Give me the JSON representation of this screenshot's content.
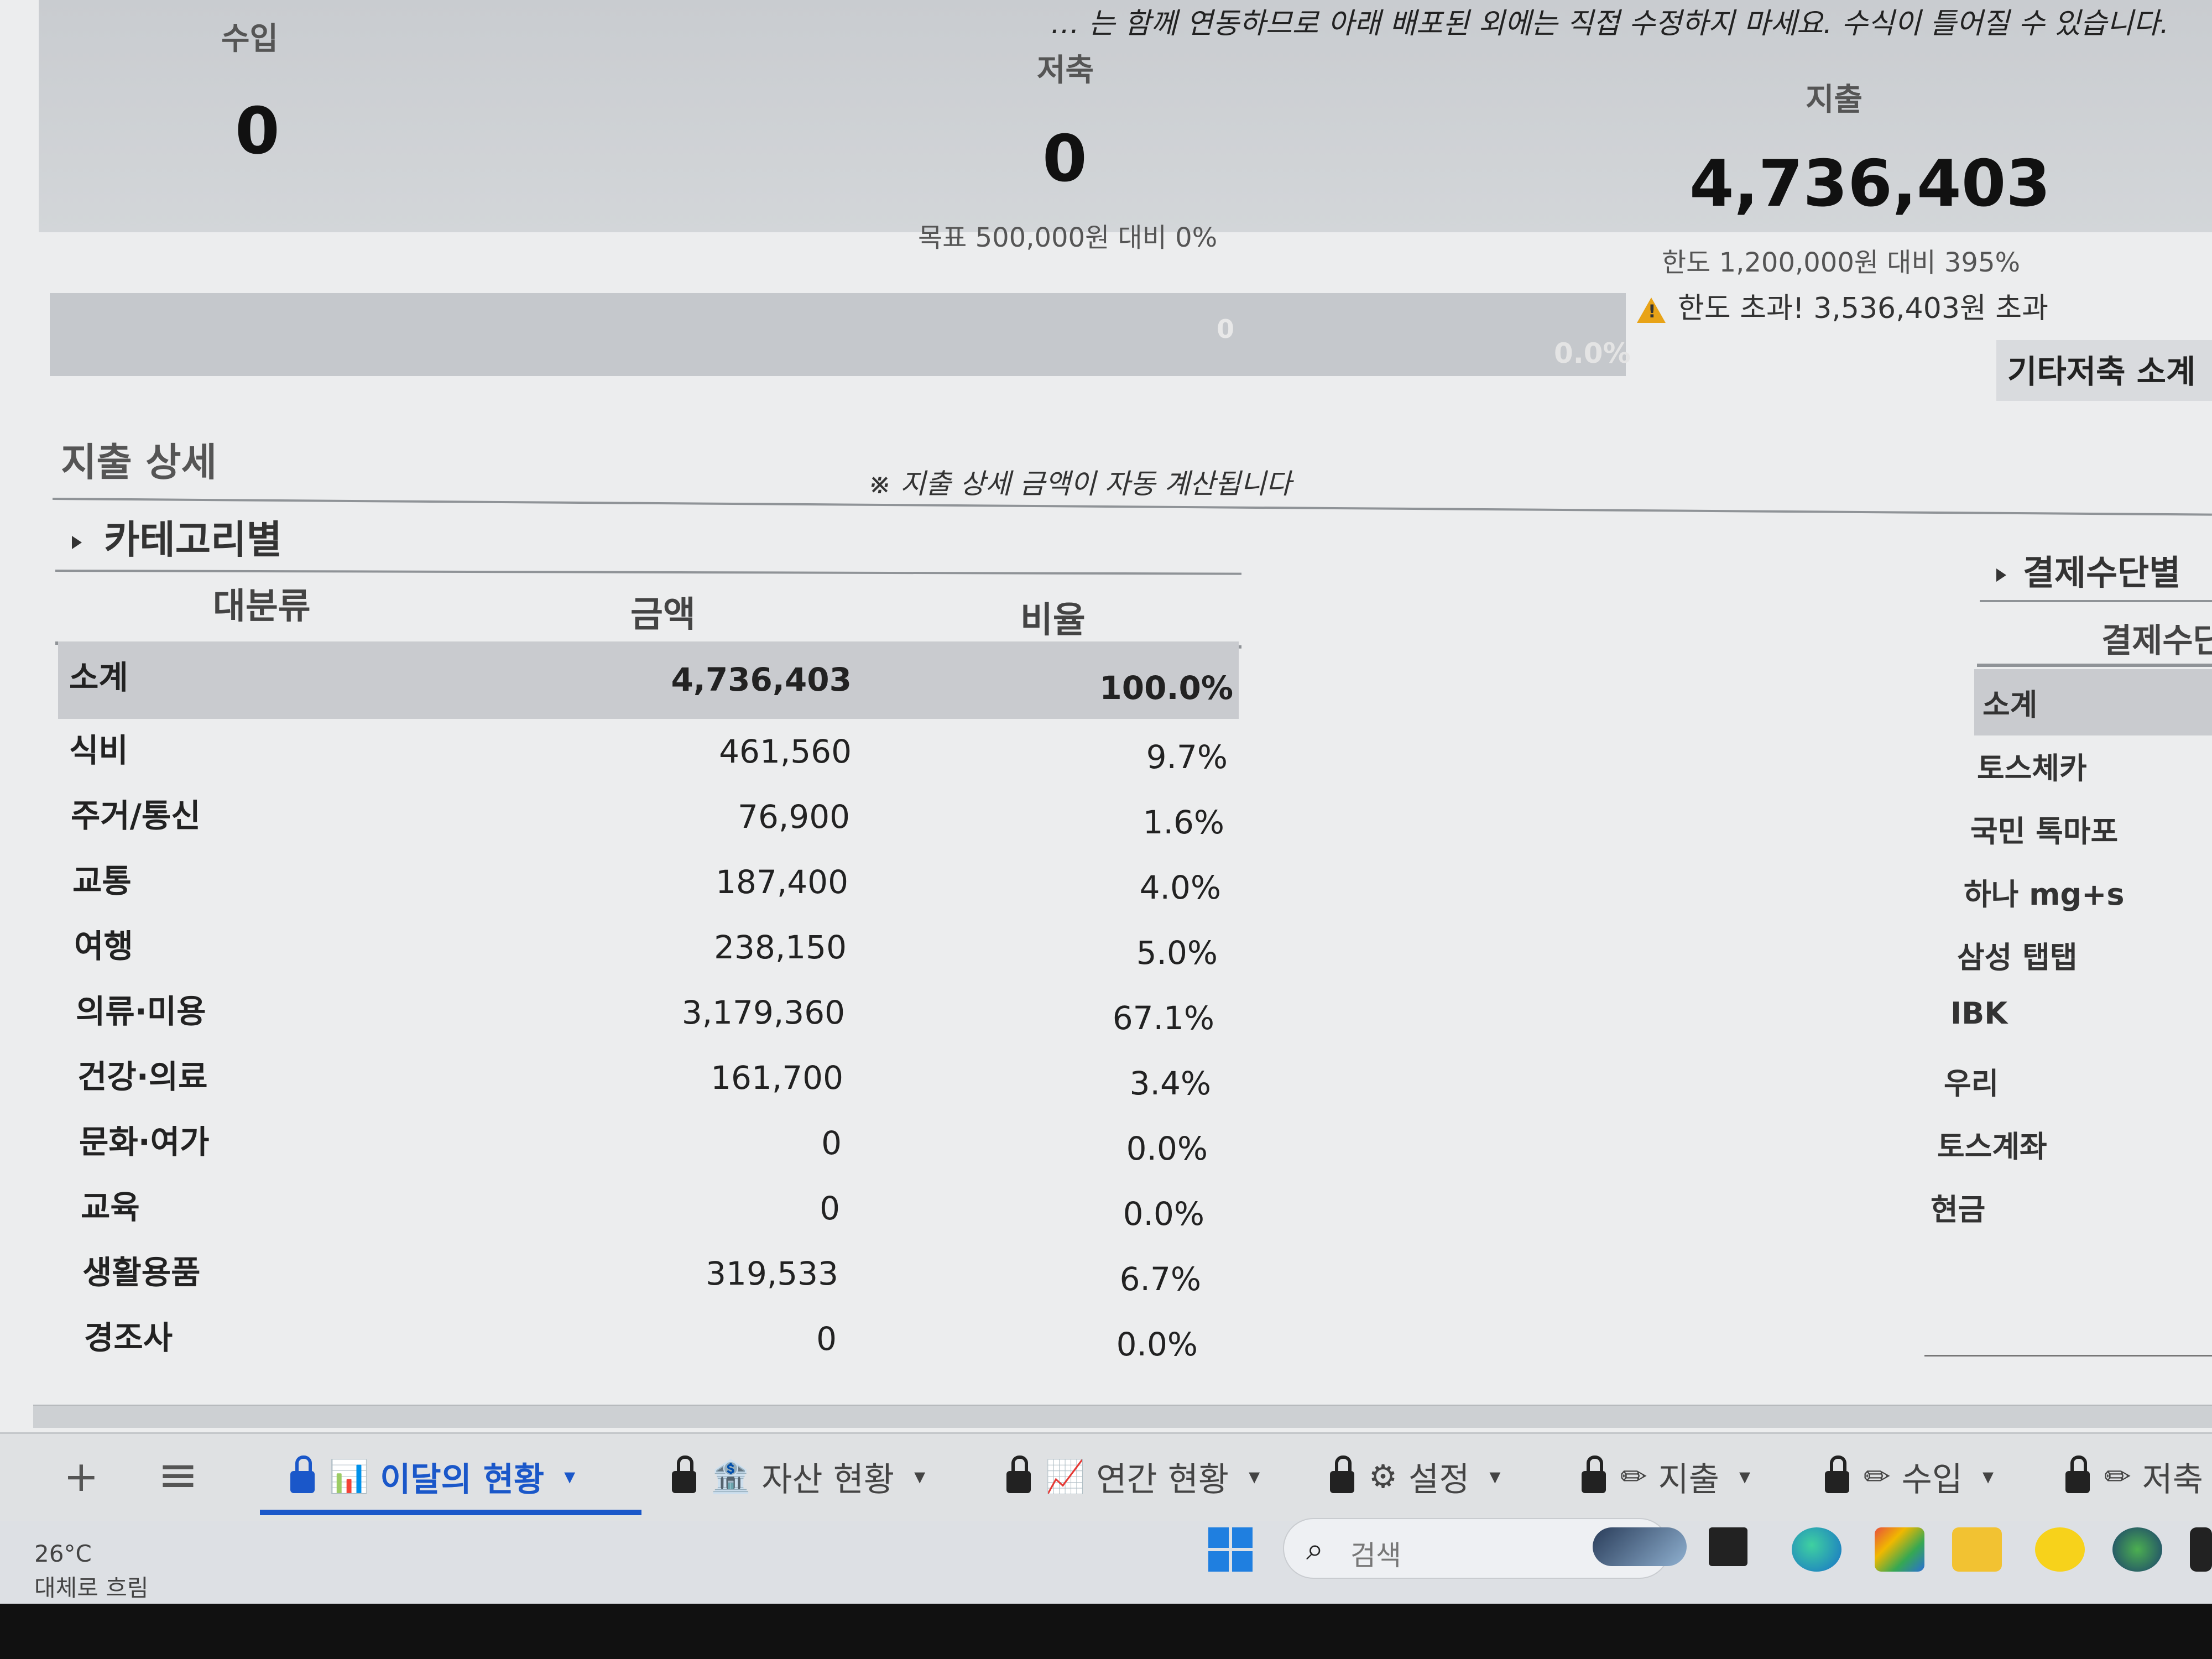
{
  "notice": "… 는 함께 연동하므로 아래 배포된 외에는 직접 수정하지 마세요. 수식이 틀어질 수 있습니다.",
  "summary": {
    "income": {
      "label": "수입",
      "value": "0"
    },
    "savings": {
      "label": "저축",
      "value": "0",
      "sub": "목표 500,000원 대비 0%"
    },
    "expense": {
      "label": "지출",
      "value": "4,736,403",
      "sub": "한도 1,200,000원 대비 395%",
      "warning": "한도 초과! 3,536,403원 초과"
    }
  },
  "savings_bar": {
    "amount": "0",
    "percent": "0.0%"
  },
  "other_savings_label": "기타저축 소계",
  "expense_detail": {
    "title": "지출 상세",
    "note": "※ 지출 상세 금액이 자동 계산됩니다",
    "by_category": {
      "title": "카테고리별",
      "headers": {
        "category": "대분류",
        "amount": "금액",
        "ratio": "비율"
      },
      "subtotal": {
        "category": "소계",
        "amount": "4,736,403",
        "ratio": "100.0%"
      },
      "rows": [
        {
          "category": "식비",
          "amount": "461,560",
          "ratio": "9.7%"
        },
        {
          "category": "주거/통신",
          "amount": "76,900",
          "ratio": "1.6%"
        },
        {
          "category": "교통",
          "amount": "187,400",
          "ratio": "4.0%"
        },
        {
          "category": "여행",
          "amount": "238,150",
          "ratio": "5.0%"
        },
        {
          "category": "의류·미용",
          "amount": "3,179,360",
          "ratio": "67.1%"
        },
        {
          "category": "건강·의료",
          "amount": "161,700",
          "ratio": "3.4%"
        },
        {
          "category": "문화·여가",
          "amount": "0",
          "ratio": "0.0%"
        },
        {
          "category": "교육",
          "amount": "0",
          "ratio": "0.0%"
        },
        {
          "category": "생활용품",
          "amount": "319,533",
          "ratio": "6.7%"
        },
        {
          "category": "경조사",
          "amount": "0",
          "ratio": "0.0%"
        }
      ]
    },
    "by_payment": {
      "title": "결제수단별",
      "header": "결제수단",
      "subtotal": "소계",
      "items": [
        "토스체카",
        "국민 톡마포",
        "하나 mg+s",
        "삼성 탭탭",
        "IBK",
        "우리",
        "토스계좌",
        "현금"
      ]
    }
  },
  "sheet_tabs": {
    "add_icon": "+",
    "menu_icon": "≡",
    "tabs": [
      {
        "label": "이달의 현황",
        "emoji": "📊",
        "active": true
      },
      {
        "label": "자산 현황",
        "emoji": "🏦",
        "active": false
      },
      {
        "label": "연간 현황",
        "emoji": "📈",
        "active": false
      },
      {
        "label": "설정",
        "emoji": "⚙",
        "active": false
      },
      {
        "label": "지출",
        "emoji": "✏",
        "active": false
      },
      {
        "label": "수입",
        "emoji": "✏",
        "active": false
      },
      {
        "label": "저축",
        "emoji": "✏",
        "active": false
      }
    ],
    "caret": "▾"
  },
  "taskbar": {
    "weather_temp": "26°C",
    "weather_desc": "대체로 흐림",
    "search_placeholder": "검색",
    "search_icon": "⌕"
  },
  "colors": {
    "accent": "#1a57c9",
    "warning": "#e8a317"
  }
}
